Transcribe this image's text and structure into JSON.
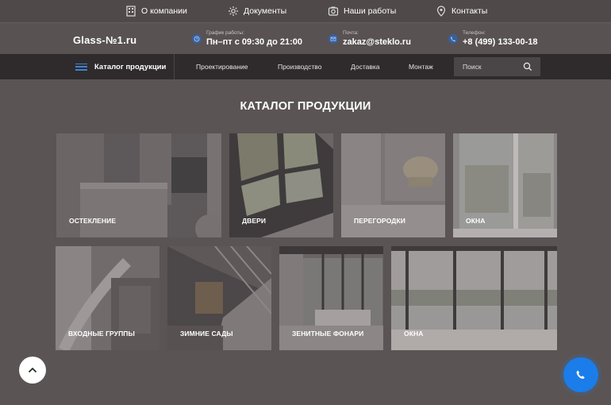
{
  "topbar": {
    "about": "О компании",
    "documents": "Документы",
    "works": "Наши работы",
    "contacts": "Контакты"
  },
  "header": {
    "logo": "Glass-№1.ru",
    "schedule_label": "График работы:",
    "schedule_value": "Пн–пт с 09:30 до 21:00",
    "email_label": "Почта:",
    "email_value": "zakaz@steklo.ru",
    "phone_label": "Телефон:",
    "phone_value": "+8 (499) 133-00-18"
  },
  "nav": {
    "catalog": "Каталог продукции",
    "links": [
      "Проектирование",
      "Производство",
      "Доставка",
      "Монтаж"
    ],
    "search_placeholder": "Поиск"
  },
  "main": {
    "title": "КАТАЛОГ ПРОДУКЦИИ",
    "cards": [
      "ОСТЕКЛЕНИЕ",
      "ДВЕРИ",
      "ПЕРЕГОРОДКИ",
      "ОКНА",
      "ВХОДНЫЕ ГРУППЫ",
      "ЗИМНИЕ САДЫ",
      "ЗЕНИТНЫЕ ФОНАРИ",
      "ОКНА"
    ]
  },
  "colors": {
    "accent": "#1a7de9",
    "background": "#5a5455",
    "nav": "#2f2b2c"
  },
  "icons": [
    "building-icon",
    "documents-icon",
    "camera-icon",
    "location-pin-icon",
    "clock-icon",
    "mail-icon",
    "phone-icon",
    "search-icon",
    "arrow-up-icon",
    "phone-call-icon",
    "burger-menu-icon"
  ]
}
